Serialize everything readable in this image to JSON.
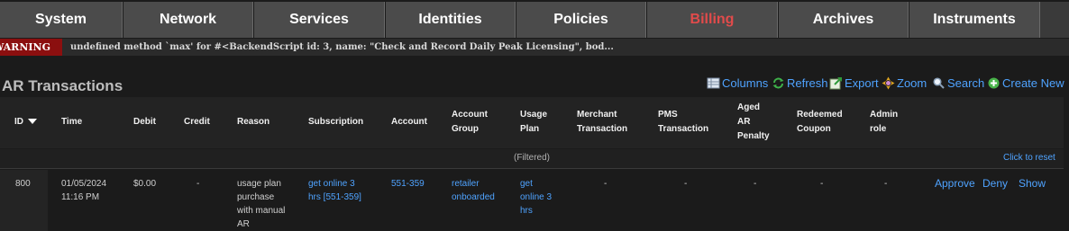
{
  "nav": {
    "tabs": [
      {
        "label": "System"
      },
      {
        "label": "Network"
      },
      {
        "label": "Services"
      },
      {
        "label": "Identities"
      },
      {
        "label": "Policies"
      },
      {
        "label": "Billing",
        "active": true
      },
      {
        "label": "Archives"
      },
      {
        "label": "Instruments"
      }
    ],
    "active_color": "#e14b4b"
  },
  "warning": {
    "badge": "WARNING",
    "message": "undefined method `max' for #<BackendScript id: 3, name: \"Check and Record Daily Peak Licensing\", bod..."
  },
  "page": {
    "title": "AR Transactions"
  },
  "toolbar": {
    "columns": "Columns",
    "refresh": "Refresh",
    "export": "Export",
    "zoom": "Zoom",
    "search": "Search",
    "create_new": "Create New"
  },
  "table": {
    "headers": {
      "id": "ID",
      "time": "Time",
      "debit": "Debit",
      "credit": "Credit",
      "reason": "Reason",
      "subscription": "Subscription",
      "account": "Account",
      "account_group": [
        "Account",
        "Group"
      ],
      "usage_plan": [
        "Usage",
        "Plan"
      ],
      "merchant_transaction": [
        "Merchant",
        "Transaction"
      ],
      "pms_transaction": [
        "PMS",
        "Transaction"
      ],
      "aged_ar_penalty": [
        "Aged",
        "AR",
        "Penalty"
      ],
      "redeemed_coupon": [
        "Redeemed",
        "Coupon"
      ],
      "admin_role": [
        "Admin",
        "role"
      ]
    },
    "filtered": "(Filtered)",
    "click_to_reset": "Click to reset",
    "rows": [
      {
        "id": "800",
        "time": [
          "01/05/2024",
          "11:16 PM"
        ],
        "debit": "$0.00",
        "credit": "-",
        "reason": [
          "usage plan",
          "purchase",
          "with manual",
          "AR"
        ],
        "subscription": [
          "get online 3",
          "hrs [551-359]"
        ],
        "account": "551-359",
        "account_group": [
          "retailer",
          "onboarded"
        ],
        "usage_plan": [
          "get",
          "online 3",
          "hrs"
        ],
        "merchant_transaction": "-",
        "pms_transaction": "-",
        "aged_ar_penalty": "-",
        "redeemed_coupon": "-",
        "admin_role": "-",
        "actions": {
          "approve": "Approve",
          "deny": "Deny",
          "show": "Show"
        }
      }
    ]
  }
}
